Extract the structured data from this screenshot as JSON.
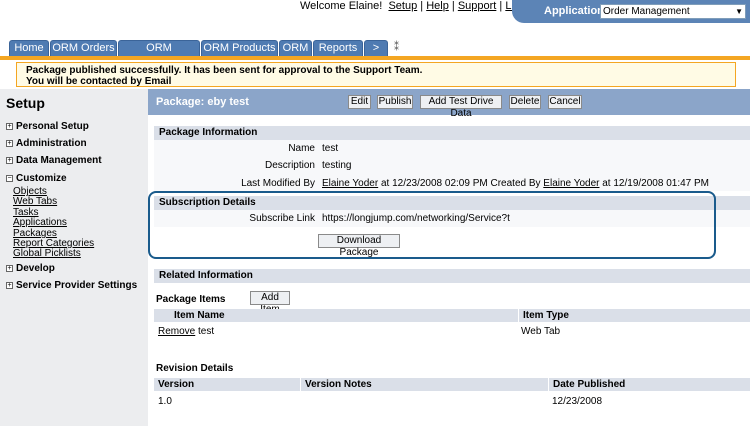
{
  "header": {
    "welcome": "Welcome Elaine!",
    "links": [
      "Setup",
      "Help",
      "Support",
      "Logout"
    ],
    "applications_label": "Applications:",
    "applications_value": "Order Management"
  },
  "tabs": [
    "Home",
    "ORM Orders",
    "ORM Customers",
    "ORM Products",
    "ORM",
    "Reports",
    ">"
  ],
  "message": {
    "line1": "Package published successfully. It has been sent for approval to the Support Team.",
    "line2": "You will be contacted by Email"
  },
  "sidebar": {
    "title": "Setup",
    "sections": {
      "personal_setup": "Personal Setup",
      "administration": "Administration",
      "data_management": "Data Management",
      "customize": "Customize",
      "develop": "Develop",
      "service_provider": "Service Provider Settings"
    },
    "customize_items": [
      "Objects",
      "Web Tabs",
      "Tasks",
      "Applications",
      "Packages",
      "Report Categories",
      "Global Picklists"
    ]
  },
  "main": {
    "title": "Package: eby test",
    "buttons": {
      "edit": "Edit",
      "publish": "Publish",
      "add_test_drive": "Add Test Drive Data",
      "delete": "Delete",
      "cancel": "Cancel"
    },
    "package_info": {
      "header": "Package Information",
      "name_label": "Name",
      "name_value": "test",
      "description_label": "Description",
      "description_value": "testing",
      "modified_label": "Last Modified By",
      "modified_user": "Elaine Yoder",
      "modified_at": "at 12/23/2008 02:09 PM",
      "created_label": "Created By",
      "created_user": "Elaine Yoder",
      "created_at": "at 12/19/2008 01:47 PM"
    },
    "subscription": {
      "header": "Subscription Details",
      "link_label": "Subscribe Link",
      "link_value": "https://longjump.com/networking/Service?t",
      "download_button": "Download Package"
    },
    "related": {
      "header": "Related Information",
      "package_items_label": "Package Items",
      "add_item_button": "Add Item",
      "columns": [
        "Item Name",
        "Item Type"
      ],
      "rows": [
        {
          "action": "Remove",
          "name": "test",
          "type": "Web Tab"
        }
      ]
    },
    "revision": {
      "label": "Revision Details",
      "columns": [
        "Version",
        "Version Notes",
        "Date Published"
      ],
      "rows": [
        {
          "version": "1.0",
          "notes": "",
          "date": "12/23/2008"
        }
      ]
    }
  }
}
